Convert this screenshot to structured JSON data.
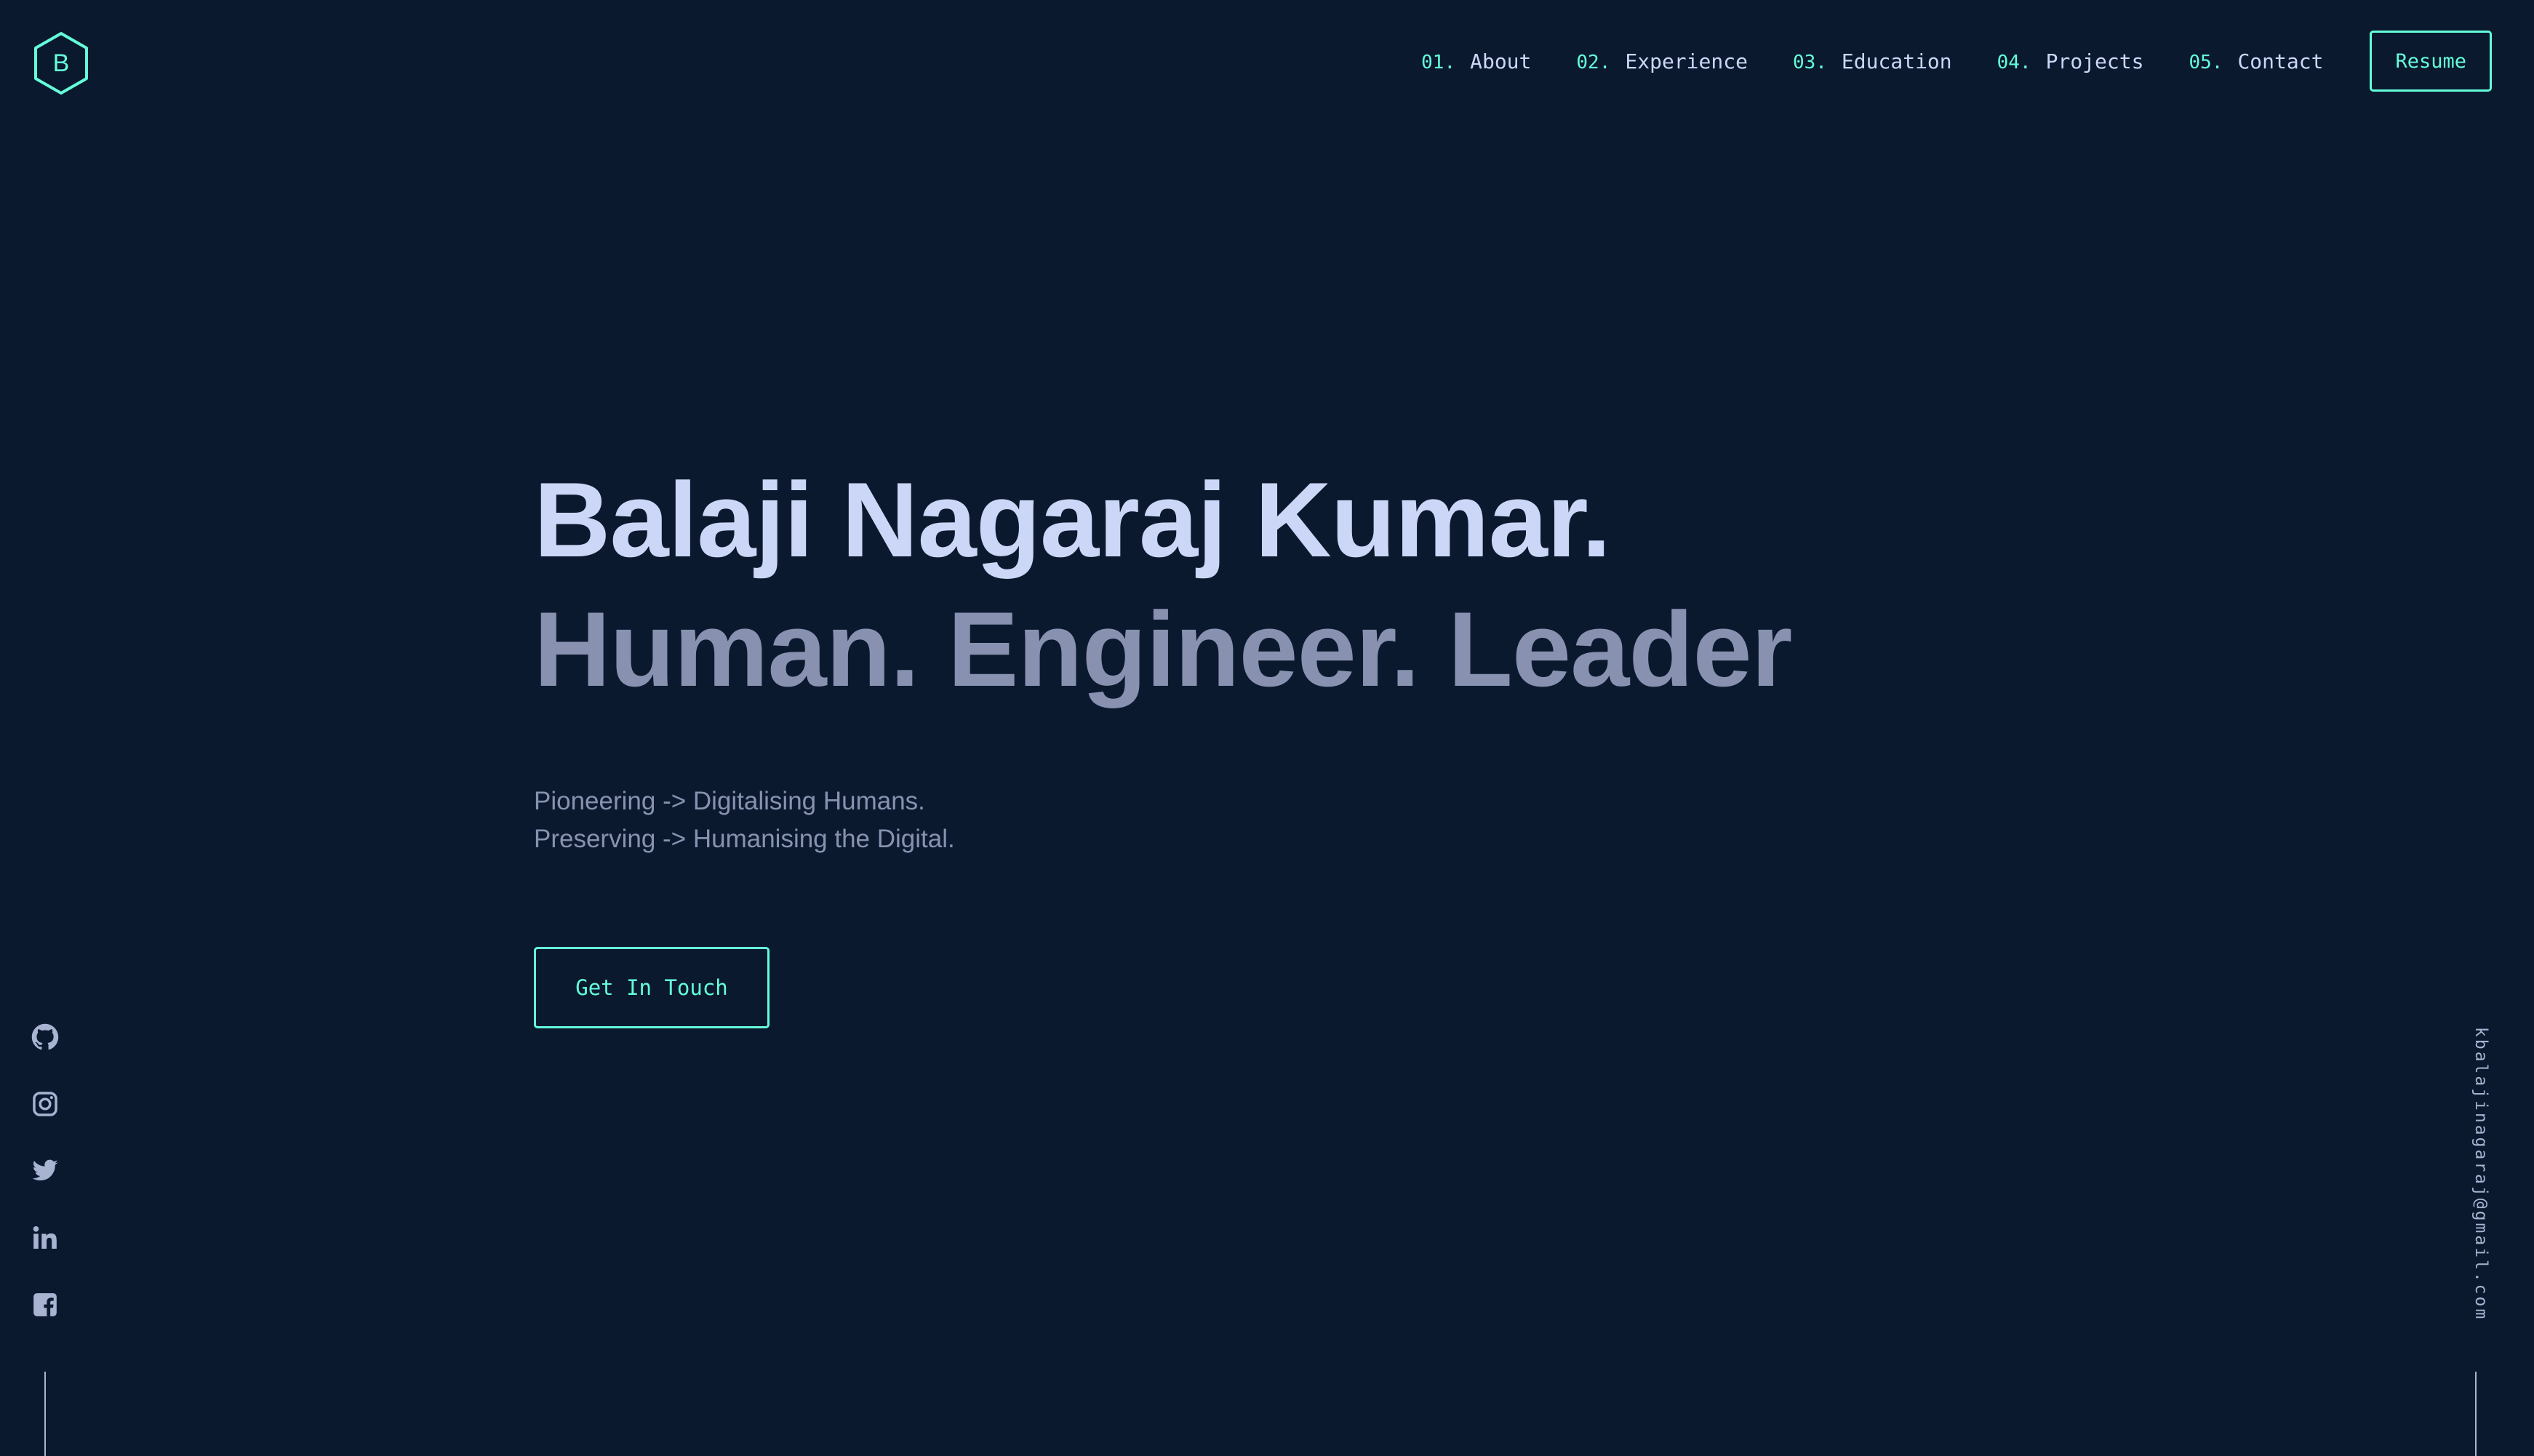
{
  "logo": {
    "letter": "B",
    "icon": "hexagon-logo-icon"
  },
  "nav": {
    "items": [
      {
        "num": "01.",
        "label": "About"
      },
      {
        "num": "02.",
        "label": "Experience"
      },
      {
        "num": "03.",
        "label": "Education"
      },
      {
        "num": "04.",
        "label": "Projects"
      },
      {
        "num": "05.",
        "label": "Contact"
      }
    ],
    "resume_label": "Resume"
  },
  "hero": {
    "name": "Balaji Nagaraj Kumar.",
    "tagline": "Human. Engineer. Leader",
    "desc_line1": "Pioneering -> Digitalising Humans.",
    "desc_line2": "Preserving -> Humanising the Digital.",
    "cta_label": "Get In Touch"
  },
  "social": {
    "icons": [
      "github-icon",
      "instagram-icon",
      "twitter-icon",
      "linkedin-icon",
      "facebook-icon"
    ]
  },
  "email": "kbalajinagaraj@gmail.com",
  "colors": {
    "background": "#0b192f",
    "accent": "#64ffda",
    "heading": "#ccd6f6",
    "text": "#8892b0"
  }
}
